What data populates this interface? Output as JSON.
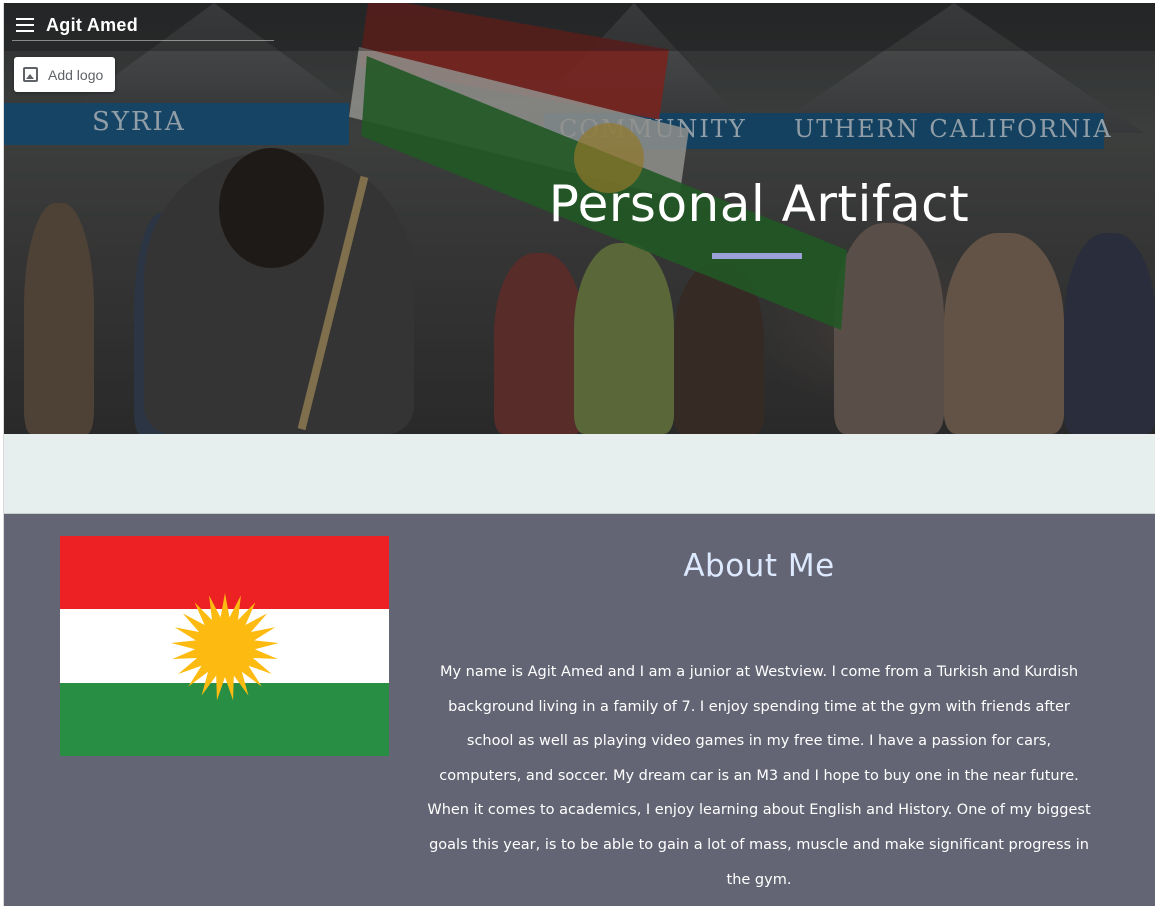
{
  "header": {
    "site_title": "Agit Amed",
    "add_logo_label": "Add logo"
  },
  "hero": {
    "heading": "Personal Artifact",
    "banner_text_left": "SYRIA",
    "banner_text_mid": "COMMUNITY",
    "banner_text_right": "UTHERN CALIFORNIA"
  },
  "about": {
    "heading": "About Me",
    "paragraph": "My name is Agit Amed and I am a junior at Westview. I come from a Turkish and Kurdish background living in a family of 7. I enjoy spending time at the gym with friends after school as well as playing video games in my free time. I have a passion for cars, computers, and soccer. My dream car is an M3 and I hope to buy one in the near future. When it comes to academics, I enjoy learning about English and History. One of my biggest goals this year, is to be able to gain a lot of mass, muscle and make significant progress in the gym."
  },
  "icons": {
    "menu": "menu-icon",
    "add_logo": "image-icon"
  },
  "colors": {
    "about_background": "#646574",
    "band_background": "#e6efed",
    "accent": "#9aa1d6",
    "about_heading": "#dce9ff",
    "flag_red": "#ed2024",
    "flag_white": "#ffffff",
    "flag_green": "#278e43",
    "flag_sun": "#fdbb11"
  }
}
